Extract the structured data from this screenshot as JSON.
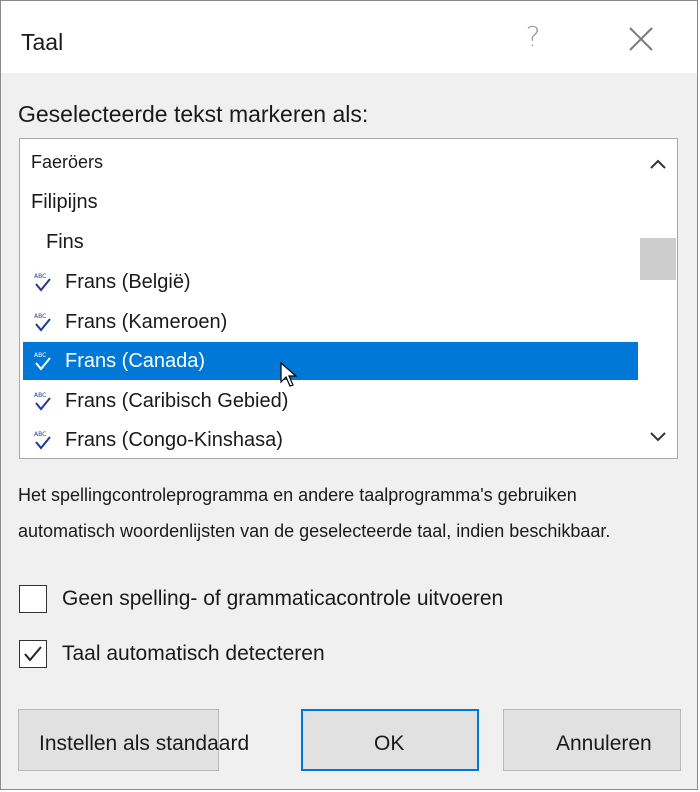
{
  "dialog": {
    "title": "Taal",
    "help_glyph": "?",
    "prompt": "Geselecteerde tekst markeren als:"
  },
  "language_list": {
    "items": [
      {
        "label": "Faeröers",
        "spell_check": false,
        "indent": "none",
        "selected": false
      },
      {
        "label": "Filipijns",
        "spell_check": false,
        "indent": "none",
        "selected": false
      },
      {
        "label": "Fins",
        "spell_check": false,
        "indent": "sub",
        "selected": false
      },
      {
        "label": "Frans (België)",
        "spell_check": true,
        "indent": "icon",
        "selected": false
      },
      {
        "label": "Frans (Kameroen)",
        "spell_check": true,
        "indent": "icon",
        "selected": false
      },
      {
        "label": "Frans (Canada)",
        "spell_check": true,
        "indent": "icon",
        "selected": true
      },
      {
        "label": "Frans (Caribisch Gebied)",
        "spell_check": true,
        "indent": "icon",
        "selected": false
      },
      {
        "label": "Frans (Congo-Kinshasa)",
        "spell_check": true,
        "indent": "icon",
        "selected": false
      }
    ],
    "icons": {
      "spell_check": "abc-checkmark-icon",
      "scroll_up": "chevron-up-icon",
      "scroll_down": "chevron-down-icon"
    }
  },
  "info": {
    "line1": "Het spellingcontroleprogramma en andere taalprogramma's gebruiken",
    "line2": "automatisch woordenlijsten van de geselecteerde taal, indien beschikbaar."
  },
  "options": {
    "no_proofing": {
      "label": "Geen spelling- of grammaticacontrole uitvoeren",
      "checked": false
    },
    "detect_language": {
      "label": "Taal automatisch detecteren",
      "checked": true
    }
  },
  "buttons": {
    "set_default": "Instellen als standaard",
    "ok": "OK",
    "cancel": "Annuleren"
  },
  "colors": {
    "selection": "#0078d7",
    "dialog_bg": "#f0f0f0",
    "list_bg": "#ffffff",
    "icon_blue": "#1f3a93"
  }
}
